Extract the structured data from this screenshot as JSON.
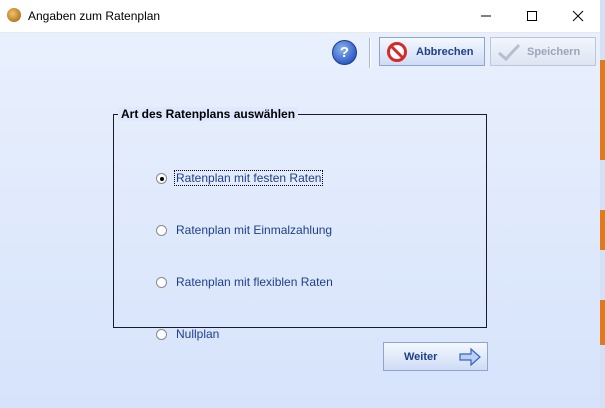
{
  "window": {
    "title": "Angaben zum Ratenplan"
  },
  "toolbar": {
    "help_glyph": "?",
    "cancel_label": "Abbrechen",
    "save_label": "Speichern",
    "save_disabled": true
  },
  "group": {
    "legend": "Art des Ratenplans auswählen",
    "options": [
      {
        "label": "Ratenplan mit festen Raten",
        "checked": true
      },
      {
        "label": "Ratenplan mit Einmalzahlung",
        "checked": false
      },
      {
        "label": "Ratenplan mit flexiblen Raten",
        "checked": false
      },
      {
        "label": "Nullplan",
        "checked": false
      }
    ]
  },
  "footer": {
    "next_label": "Weiter"
  },
  "icons": {
    "app": "app-coin-icon",
    "help": "help-icon",
    "cancel": "cancel-icon",
    "save": "checkmark-icon",
    "next": "arrow-right-icon"
  },
  "colors": {
    "content_bg_top": "#e9f0fd",
    "content_bg_bottom": "#d6e3fb",
    "label_text": "#1f3f8a",
    "cancel_red": "#d42a2a"
  }
}
